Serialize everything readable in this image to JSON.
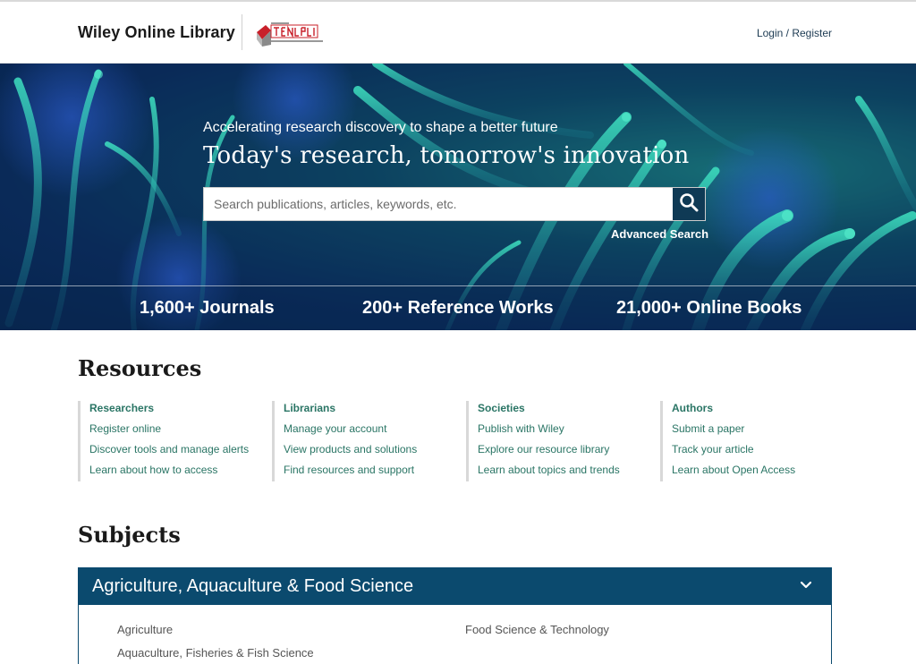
{
  "header": {
    "brand": "Wiley Online Library",
    "login_label": "Login / Register"
  },
  "hero": {
    "tagline": "Accelerating research discovery to shape a better future",
    "headline": "Today's research, tomorrow's innovation",
    "search": {
      "placeholder": "Search publications, articles, keywords, etc."
    },
    "advanced_search_label": "Advanced Search",
    "stats": [
      "1,600+ Journals",
      "200+ Reference Works",
      "21,000+ Online Books"
    ]
  },
  "resources": {
    "title": "Resources",
    "columns": [
      {
        "title": "Researchers",
        "links": [
          "Register online",
          "Discover tools and manage alerts",
          "Learn about how to access"
        ]
      },
      {
        "title": "Librarians",
        "links": [
          "Manage your account",
          "View products and solutions",
          "Find resources and support"
        ]
      },
      {
        "title": "Societies",
        "links": [
          "Publish with Wiley",
          "Explore our resource library",
          "Learn about topics and trends"
        ]
      },
      {
        "title": "Authors",
        "links": [
          "Submit a paper",
          "Track your article",
          "Learn about Open Access"
        ]
      }
    ]
  },
  "subjects": {
    "title": "Subjects",
    "expanded": {
      "label": "Agriculture, Aquaculture & Food Science",
      "items": [
        "Agriculture",
        "Food Science & Technology",
        "Aquaculture, Fisheries & Fish Science"
      ]
    }
  },
  "colors": {
    "brand_dark": "#0b4a6e",
    "search_button": "#0f3a55",
    "link_green": "#2a7565",
    "heading_green": "#1f6b5d"
  },
  "icons": [
    "search-icon",
    "chevron-down-icon",
    "institution-logo"
  ]
}
